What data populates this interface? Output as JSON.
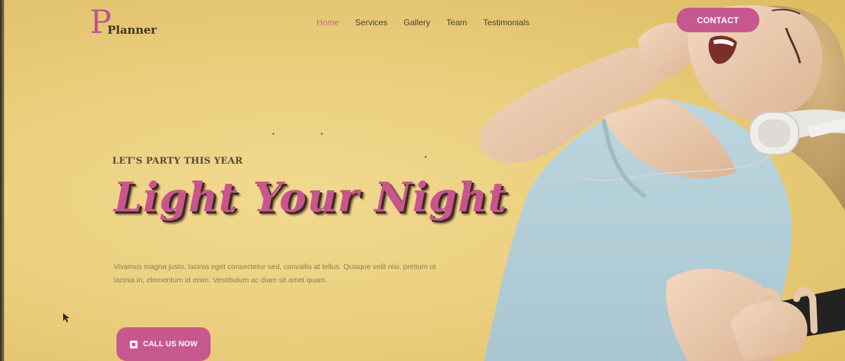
{
  "brand": {
    "logo_letter": "P",
    "logo_text": "Planner"
  },
  "nav": {
    "items": [
      {
        "label": "Home",
        "active": true
      },
      {
        "label": "Services",
        "active": false
      },
      {
        "label": "Gallery",
        "active": false
      },
      {
        "label": "Team",
        "active": false
      },
      {
        "label": "Testimonials",
        "active": false
      }
    ],
    "contact_label": "CONTACT"
  },
  "hero": {
    "tagline": "LET'S PARTY THIS YEAR",
    "headline": "Light Your Night",
    "body": "Vivamus magna justo, lacinia eget consectetur sed, convallis at tellus. Quisque velit nisi, pretium ut lacinia in, elementum id enim. Vestibulum ac diam sit amet quam.",
    "cta_label": "CALL US NOW",
    "cta_icon": "phone-icon"
  },
  "colors": {
    "accent": "#c7588f",
    "background": "#ebcf7e",
    "headline": "#c9558d",
    "text_dark": "#4a4033"
  }
}
